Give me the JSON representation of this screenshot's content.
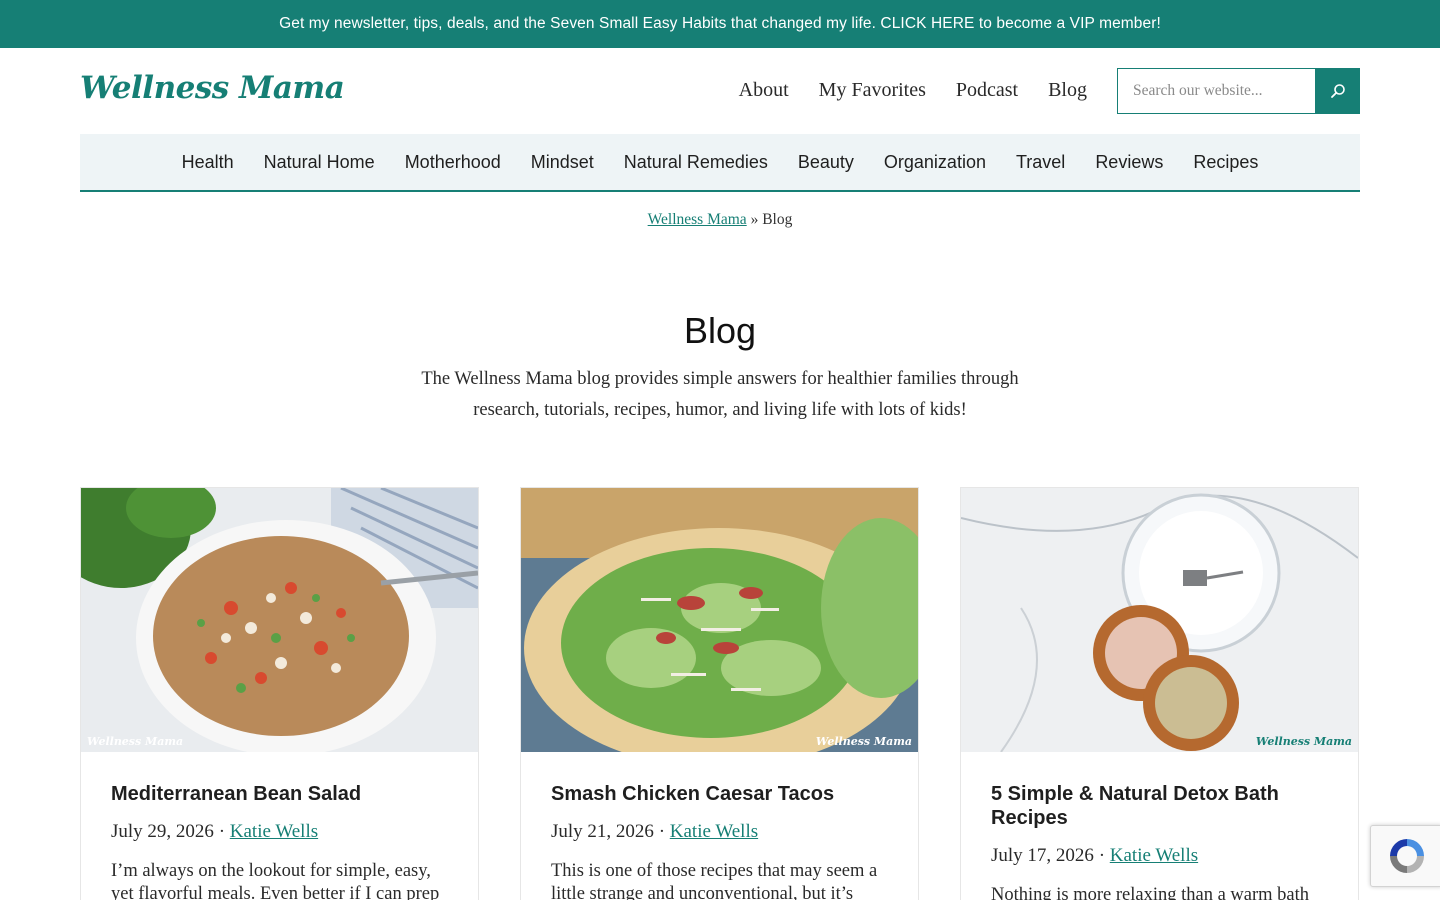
{
  "topbar": {
    "text": "Get my newsletter, tips, deals, and the Seven Small Easy Habits that changed my life. CLICK HERE to become a VIP member!"
  },
  "header": {
    "logo": "Wellness Mama",
    "nav": [
      "About",
      "My Favorites",
      "Podcast",
      "Blog"
    ],
    "search_placeholder": "Search our website...",
    "search_icon": "search-icon"
  },
  "catnav": [
    "Health",
    "Natural Home",
    "Motherhood",
    "Mindset",
    "Natural Remedies",
    "Beauty",
    "Organization",
    "Travel",
    "Reviews",
    "Recipes"
  ],
  "breadcrumb": {
    "home": "Wellness Mama",
    "separator": "»",
    "current": "Blog"
  },
  "page": {
    "title": "Blog",
    "intro": "The Wellness Mama blog provides simple answers for healthier families through research, tutorials, recipes, humor, and living life with lots of kids!"
  },
  "posts": [
    {
      "title": "Mediterranean Bean Salad",
      "date": "July 29, 2026",
      "sep": "·",
      "author": "Katie Wells",
      "excerpt": "I’m always on the lookout for simple, easy, yet flavorful meals. Even better if I can prep",
      "watermark": "Wellness Mama"
    },
    {
      "title": "Smash Chicken Caesar Tacos",
      "date": "July 21, 2026",
      "sep": "·",
      "author": "Katie Wells",
      "excerpt": "This is one of those recipes that may seem a little strange and unconventional, but it’s",
      "watermark": "Wellness Mama"
    },
    {
      "title": "5 Simple & Natural Detox Bath Recipes",
      "date": "July 17, 2026",
      "sep": "·",
      "author": "Katie Wells",
      "excerpt": "Nothing is more relaxing than a warm bath",
      "watermark": "Wellness Mama"
    }
  ],
  "colors": {
    "brand": "#167f75",
    "nav_bg": "#eef4f6"
  }
}
